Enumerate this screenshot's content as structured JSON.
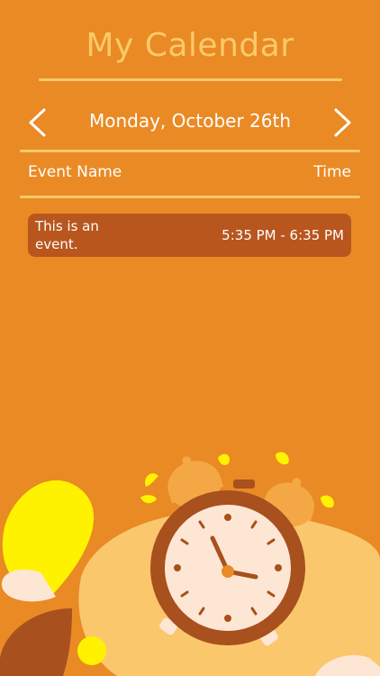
{
  "header": {
    "title": "My Calendar"
  },
  "date_nav": {
    "current_date": "Monday, October 26th",
    "prev_icon": "chevron-left-icon",
    "next_icon": "chevron-right-icon"
  },
  "columns": {
    "event_name": "Event Name",
    "time": "Time"
  },
  "events": [
    {
      "name": "This is an event.",
      "time": "5:35 PM - 6:35 PM"
    }
  ],
  "colors": {
    "background": "#e98a24",
    "title": "#fcc96a",
    "rule": "#fbc86a",
    "event_bg": "#b8561e",
    "clock_body": "#a8501e",
    "clock_face": "#fde7d4"
  },
  "illustration": "alarm-clock-illustration"
}
